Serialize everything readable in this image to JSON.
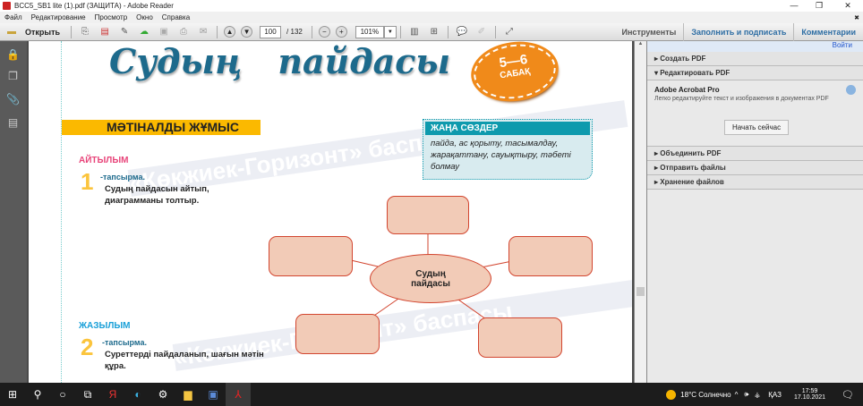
{
  "window": {
    "title": "BCC5_SB1 lite (1).pdf (ЗАЩИТА) - Adobe Reader",
    "minimize": "—",
    "restore": "❐",
    "close": "✕"
  },
  "menu": [
    "Файл",
    "Редактирование",
    "Просмотр",
    "Окно",
    "Справка"
  ],
  "toolbar": {
    "open_label": "Открыть",
    "page_current": "100",
    "page_total": "/ 132",
    "zoom": "101%",
    "tools": "Инструменты",
    "fill_sign": "Заполнить и подписать",
    "comments": "Комментарии",
    "close_x": "✖"
  },
  "page": {
    "title": "Судың   пайдасы",
    "badge_range": "5—6",
    "badge_word": "САБАҚ",
    "section": "МӘТІНАЛДЫ ЖҰМЫС",
    "watermark": "«Көкжиек-Горизонт» баспасы",
    "new_words": {
      "header": "ЖАҢА СӨЗДЕР",
      "body": "пайда, ас қорыту, тасымалдау, жарақаттану, сауықтыру, тәбеті болмау"
    },
    "task1": {
      "category": "АЙТЫЛЫМ",
      "num": "1",
      "label": "-тапсырма.",
      "text": "Судың пайдасын айтып, диаграмманы толтыр."
    },
    "task2": {
      "category": "ЖАЗЫЛЫМ",
      "num": "2",
      "label": "-тапсырма.",
      "text": "Суреттерді пайдаланып, шағын мәтін құра."
    },
    "center": "Судың пайдасы"
  },
  "panel": {
    "login": "Войти",
    "sections": [
      "Создать PDF",
      "Редактировать PDF",
      "Объединить PDF",
      "Отправить файлы",
      "Хранение файлов"
    ],
    "promo_title": "Adobe Acrobat Pro",
    "promo_text": "Легко редактируйте текст и изображения в документах PDF",
    "promo_button": "Начать сейчас"
  },
  "taskbar": {
    "weather": "18°C  Солнечно",
    "lang": "ҚАЗ",
    "time": "17:59",
    "date": "17.10.2021"
  },
  "colors": {
    "accent_blue": "#1d6a8c",
    "orange": "#f08a1a",
    "yellow": "#fbb900",
    "teal": "#0e9aad",
    "pink": "#e8457a"
  }
}
